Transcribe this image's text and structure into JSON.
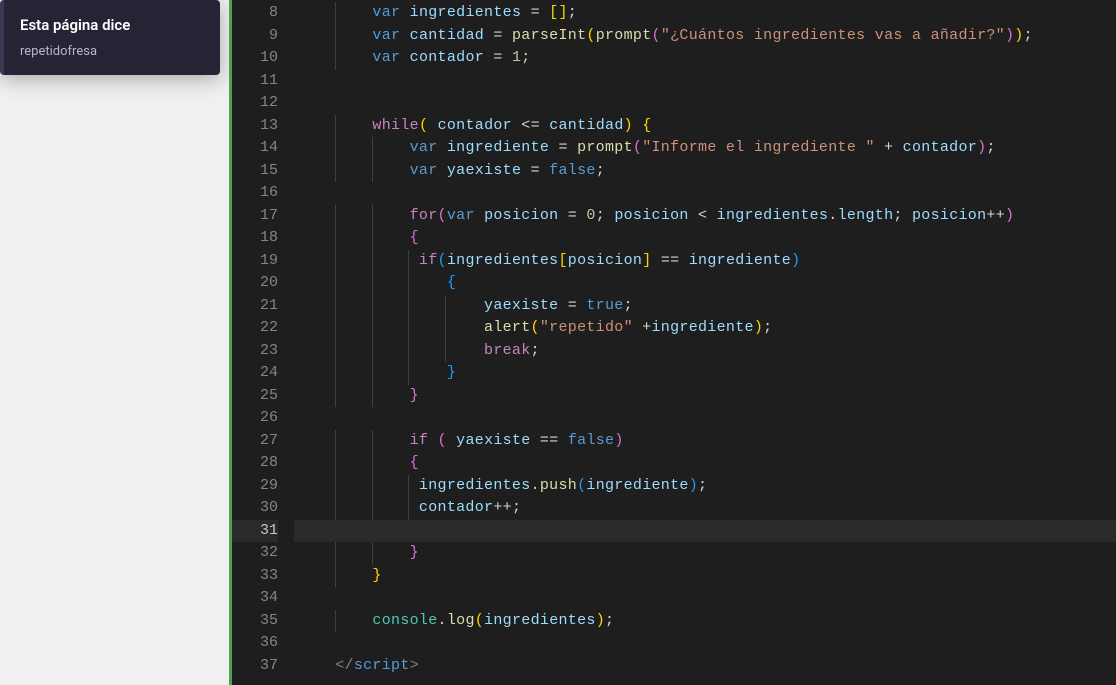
{
  "dialog": {
    "title": "Esta página dice",
    "message": "repetidofresa"
  },
  "gutter": {
    "start": 8,
    "end": 37,
    "active": 31
  },
  "code": {
    "lines": [
      {
        "n": 8,
        "indent": 8,
        "tokens": [
          {
            "c": "kw",
            "t": "var"
          },
          {
            "c": "op",
            "t": " "
          },
          {
            "c": "ident",
            "t": "ingredientes"
          },
          {
            "c": "op",
            "t": " = "
          },
          {
            "c": "paren-y",
            "t": "["
          },
          {
            "c": "paren-y",
            "t": "]"
          },
          {
            "c": "op",
            "t": ";"
          }
        ]
      },
      {
        "n": 9,
        "indent": 8,
        "tokens": [
          {
            "c": "kw",
            "t": "var"
          },
          {
            "c": "op",
            "t": " "
          },
          {
            "c": "ident",
            "t": "cantidad"
          },
          {
            "c": "op",
            "t": " = "
          },
          {
            "c": "func",
            "t": "parseInt"
          },
          {
            "c": "paren-y",
            "t": "("
          },
          {
            "c": "func",
            "t": "prompt"
          },
          {
            "c": "paren-p",
            "t": "("
          },
          {
            "c": "str",
            "t": "\"¿Cuántos ingredientes vas a añadir?\""
          },
          {
            "c": "paren-p",
            "t": ")"
          },
          {
            "c": "paren-y",
            "t": ")"
          },
          {
            "c": "op",
            "t": ";"
          }
        ]
      },
      {
        "n": 10,
        "indent": 8,
        "tokens": [
          {
            "c": "kw",
            "t": "var"
          },
          {
            "c": "op",
            "t": " "
          },
          {
            "c": "ident",
            "t": "contador"
          },
          {
            "c": "op",
            "t": " = "
          },
          {
            "c": "num",
            "t": "1"
          },
          {
            "c": "op",
            "t": ";"
          }
        ]
      },
      {
        "n": 11,
        "indent": 0,
        "tokens": []
      },
      {
        "n": 12,
        "indent": 0,
        "tokens": []
      },
      {
        "n": 13,
        "indent": 8,
        "tokens": [
          {
            "c": "kw2",
            "t": "while"
          },
          {
            "c": "paren-y",
            "t": "("
          },
          {
            "c": "op",
            "t": " "
          },
          {
            "c": "ident",
            "t": "contador"
          },
          {
            "c": "op",
            "t": " <= "
          },
          {
            "c": "ident",
            "t": "cantidad"
          },
          {
            "c": "paren-y",
            "t": ")"
          },
          {
            "c": "op",
            "t": " "
          },
          {
            "c": "paren-y",
            "t": "{"
          }
        ]
      },
      {
        "n": 14,
        "indent": 12,
        "tokens": [
          {
            "c": "kw",
            "t": "var"
          },
          {
            "c": "op",
            "t": " "
          },
          {
            "c": "ident",
            "t": "ingrediente"
          },
          {
            "c": "op",
            "t": " = "
          },
          {
            "c": "func",
            "t": "prompt"
          },
          {
            "c": "paren-p",
            "t": "("
          },
          {
            "c": "str",
            "t": "\"Informe el ingrediente \""
          },
          {
            "c": "op",
            "t": " + "
          },
          {
            "c": "ident",
            "t": "contador"
          },
          {
            "c": "paren-p",
            "t": ")"
          },
          {
            "c": "op",
            "t": ";"
          }
        ]
      },
      {
        "n": 15,
        "indent": 12,
        "tokens": [
          {
            "c": "kw",
            "t": "var"
          },
          {
            "c": "op",
            "t": " "
          },
          {
            "c": "ident",
            "t": "yaexiste"
          },
          {
            "c": "op",
            "t": " = "
          },
          {
            "c": "bool",
            "t": "false"
          },
          {
            "c": "op",
            "t": ";"
          }
        ]
      },
      {
        "n": 16,
        "indent": 0,
        "tokens": []
      },
      {
        "n": 17,
        "indent": 12,
        "tokens": [
          {
            "c": "kw2",
            "t": "for"
          },
          {
            "c": "paren-p",
            "t": "("
          },
          {
            "c": "kw",
            "t": "var"
          },
          {
            "c": "op",
            "t": " "
          },
          {
            "c": "ident",
            "t": "posicion"
          },
          {
            "c": "op",
            "t": " = "
          },
          {
            "c": "num",
            "t": "0"
          },
          {
            "c": "op",
            "t": "; "
          },
          {
            "c": "ident",
            "t": "posicion"
          },
          {
            "c": "op",
            "t": " < "
          },
          {
            "c": "ident",
            "t": "ingredientes"
          },
          {
            "c": "op",
            "t": "."
          },
          {
            "c": "prop",
            "t": "length"
          },
          {
            "c": "op",
            "t": "; "
          },
          {
            "c": "ident",
            "t": "posicion"
          },
          {
            "c": "op",
            "t": "++"
          },
          {
            "c": "paren-p",
            "t": ")"
          }
        ]
      },
      {
        "n": 18,
        "indent": 12,
        "tokens": [
          {
            "c": "paren-p",
            "t": "{"
          }
        ]
      },
      {
        "n": 19,
        "indent": 13,
        "tokens": [
          {
            "c": "kw2",
            "t": "if"
          },
          {
            "c": "paren-b",
            "t": "("
          },
          {
            "c": "ident",
            "t": "ingredientes"
          },
          {
            "c": "paren-y",
            "t": "["
          },
          {
            "c": "ident",
            "t": "posicion"
          },
          {
            "c": "paren-y",
            "t": "]"
          },
          {
            "c": "op",
            "t": " == "
          },
          {
            "c": "ident",
            "t": "ingrediente"
          },
          {
            "c": "paren-b",
            "t": ")"
          }
        ]
      },
      {
        "n": 20,
        "indent": 16,
        "tokens": [
          {
            "c": "paren-b",
            "t": "{"
          }
        ]
      },
      {
        "n": 21,
        "indent": 20,
        "tokens": [
          {
            "c": "ident",
            "t": "yaexiste"
          },
          {
            "c": "op",
            "t": " = "
          },
          {
            "c": "bool",
            "t": "true"
          },
          {
            "c": "op",
            "t": ";"
          }
        ]
      },
      {
        "n": 22,
        "indent": 20,
        "tokens": [
          {
            "c": "func",
            "t": "alert"
          },
          {
            "c": "paren-y",
            "t": "("
          },
          {
            "c": "str",
            "t": "\"repetido\""
          },
          {
            "c": "op",
            "t": " +"
          },
          {
            "c": "ident",
            "t": "ingrediente"
          },
          {
            "c": "paren-y",
            "t": ")"
          },
          {
            "c": "op",
            "t": ";"
          }
        ]
      },
      {
        "n": 23,
        "indent": 20,
        "tokens": [
          {
            "c": "kw2",
            "t": "break"
          },
          {
            "c": "op",
            "t": ";"
          }
        ]
      },
      {
        "n": 24,
        "indent": 16,
        "tokens": [
          {
            "c": "paren-b",
            "t": "}"
          }
        ]
      },
      {
        "n": 25,
        "indent": 12,
        "tokens": [
          {
            "c": "paren-p",
            "t": "}"
          }
        ]
      },
      {
        "n": 26,
        "indent": 0,
        "tokens": []
      },
      {
        "n": 27,
        "indent": 12,
        "tokens": [
          {
            "c": "kw2",
            "t": "if"
          },
          {
            "c": "op",
            "t": " "
          },
          {
            "c": "paren-p",
            "t": "("
          },
          {
            "c": "op",
            "t": " "
          },
          {
            "c": "ident",
            "t": "yaexiste"
          },
          {
            "c": "op",
            "t": " == "
          },
          {
            "c": "bool",
            "t": "false"
          },
          {
            "c": "paren-p",
            "t": ")"
          }
        ]
      },
      {
        "n": 28,
        "indent": 12,
        "tokens": [
          {
            "c": "paren-p",
            "t": "{"
          }
        ]
      },
      {
        "n": 29,
        "indent": 13,
        "tokens": [
          {
            "c": "ident",
            "t": "ingredientes"
          },
          {
            "c": "op",
            "t": "."
          },
          {
            "c": "func",
            "t": "push"
          },
          {
            "c": "paren-b",
            "t": "("
          },
          {
            "c": "ident",
            "t": "ingrediente"
          },
          {
            "c": "paren-b",
            "t": ")"
          },
          {
            "c": "op",
            "t": ";"
          }
        ]
      },
      {
        "n": 30,
        "indent": 13,
        "tokens": [
          {
            "c": "ident",
            "t": "contador"
          },
          {
            "c": "op",
            "t": "++;"
          }
        ]
      },
      {
        "n": 31,
        "indent": 0,
        "tokens": []
      },
      {
        "n": 32,
        "indent": 12,
        "tokens": [
          {
            "c": "paren-p",
            "t": "}"
          }
        ]
      },
      {
        "n": 33,
        "indent": 8,
        "tokens": [
          {
            "c": "paren-y",
            "t": "}"
          }
        ]
      },
      {
        "n": 34,
        "indent": 0,
        "tokens": []
      },
      {
        "n": 35,
        "indent": 8,
        "tokens": [
          {
            "c": "obj",
            "t": "console"
          },
          {
            "c": "op",
            "t": "."
          },
          {
            "c": "func",
            "t": "log"
          },
          {
            "c": "paren-y",
            "t": "("
          },
          {
            "c": "ident",
            "t": "ingredientes"
          },
          {
            "c": "paren-y",
            "t": ")"
          },
          {
            "c": "op",
            "t": ";"
          }
        ]
      },
      {
        "n": 36,
        "indent": 0,
        "tokens": []
      },
      {
        "n": 37,
        "indent": 4,
        "tokens": [
          {
            "c": "punct",
            "t": "</"
          },
          {
            "c": "tag",
            "t": "script"
          },
          {
            "c": "punct",
            "t": ">"
          }
        ]
      }
    ]
  }
}
